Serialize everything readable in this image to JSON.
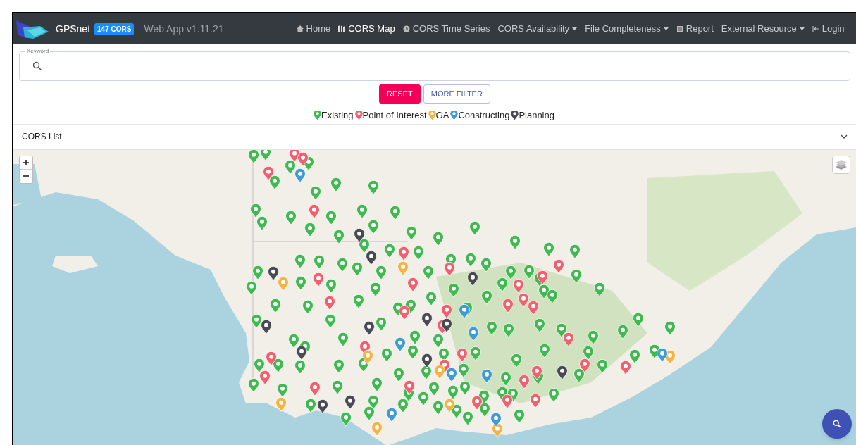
{
  "navbar": {
    "brand": "GPSnet",
    "badge": "147 CORS",
    "version": "Web App v1.11.21",
    "items": [
      {
        "label": "Home",
        "dropdown": false,
        "selected": false
      },
      {
        "label": "CORS Map",
        "dropdown": false,
        "selected": true
      },
      {
        "label": "CORS Time Series",
        "dropdown": false,
        "selected": false
      },
      {
        "label": "CORS Availability",
        "dropdown": true,
        "selected": false
      },
      {
        "label": "File Completeness",
        "dropdown": true,
        "selected": false
      },
      {
        "label": "Report",
        "dropdown": false,
        "selected": false
      },
      {
        "label": "External Resource",
        "dropdown": true,
        "selected": false
      },
      {
        "label": "Login",
        "dropdown": false,
        "selected": false
      }
    ]
  },
  "search": {
    "label": "Keyword"
  },
  "buttons": [
    {
      "label": "RESET",
      "kind": "primary"
    },
    {
      "label": "MORE FILTER",
      "kind": "outline"
    }
  ],
  "legend": [
    {
      "label": "Existing",
      "color": "#3fb950"
    },
    {
      "label": "Point of Interest",
      "color": "#f0606e"
    },
    {
      "label": "GA",
      "color": "#f5b342"
    },
    {
      "label": "Constructing",
      "color": "#3d9bd6"
    },
    {
      "label": "Planning",
      "color": "#4a4a55"
    }
  ],
  "cors_list": {
    "title": "CORS List",
    "expanded": false
  }
}
